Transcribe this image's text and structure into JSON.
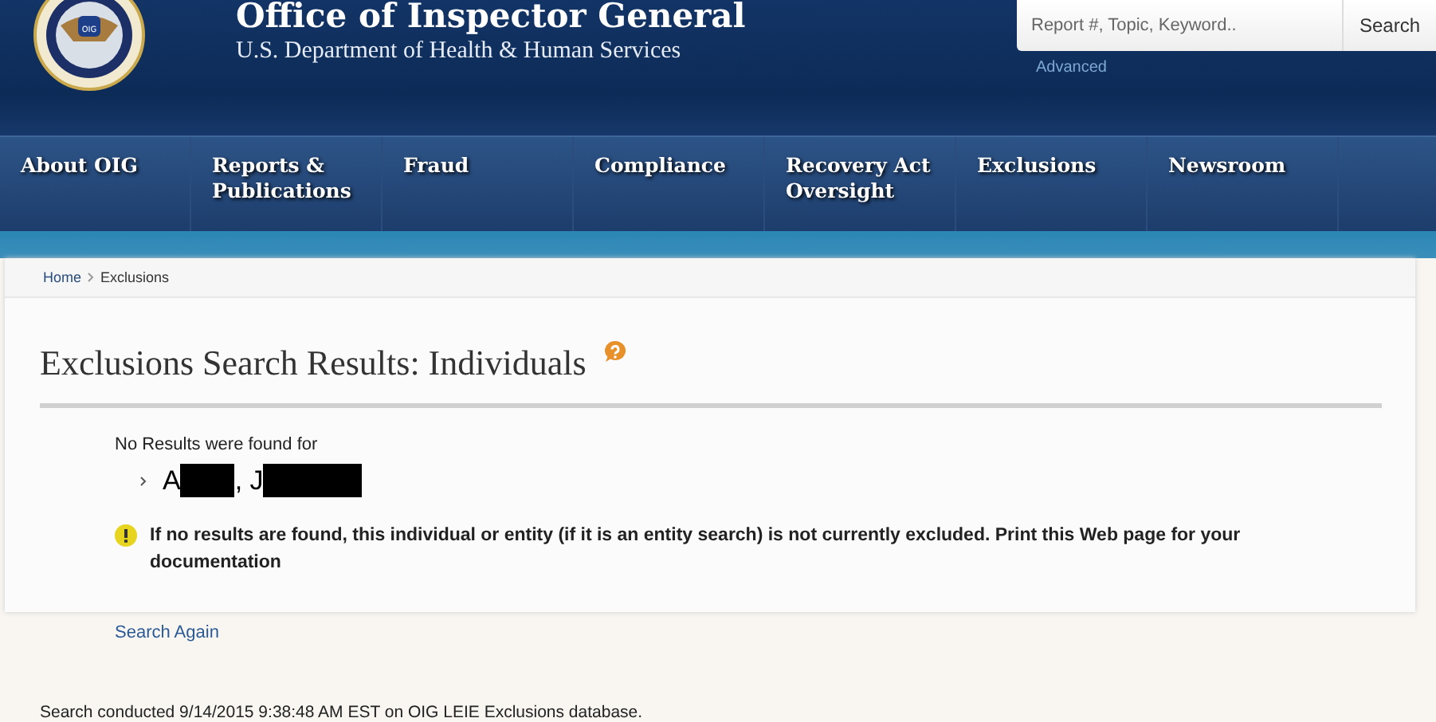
{
  "header": {
    "title": "Office of Inspector General",
    "subtitle": "U.S. Department of Health & Human Services",
    "seal_text": "OIG"
  },
  "search": {
    "placeholder": "Report #, Topic, Keyword..",
    "button": "Search",
    "advanced": "Advanced"
  },
  "nav": [
    {
      "label": "About OIG"
    },
    {
      "label": "Reports & Publications"
    },
    {
      "label": "Fraud"
    },
    {
      "label": "Compliance"
    },
    {
      "label": "Recovery Act Oversight"
    },
    {
      "label": "Exclusions"
    },
    {
      "label": "Newsroom"
    }
  ],
  "breadcrumb": [
    "Home",
    "Exclusions"
  ],
  "page_title": "Exclusions Search Results: Individuals",
  "no_results_label": "No Results were found for",
  "name_parts": [
    {
      "text": "A",
      "redacted": true
    },
    {
      "text": ", J",
      "redacted": true
    }
  ],
  "notice": "If no results are found, this individual or entity (if it is an entity search) is not currently excluded. Print this Web page for your documentation",
  "search_again": "Search Again",
  "footer_note": "Search conducted 9/14/2015 9:38:48 AM EST on OIG LEIE Exclusions database."
}
